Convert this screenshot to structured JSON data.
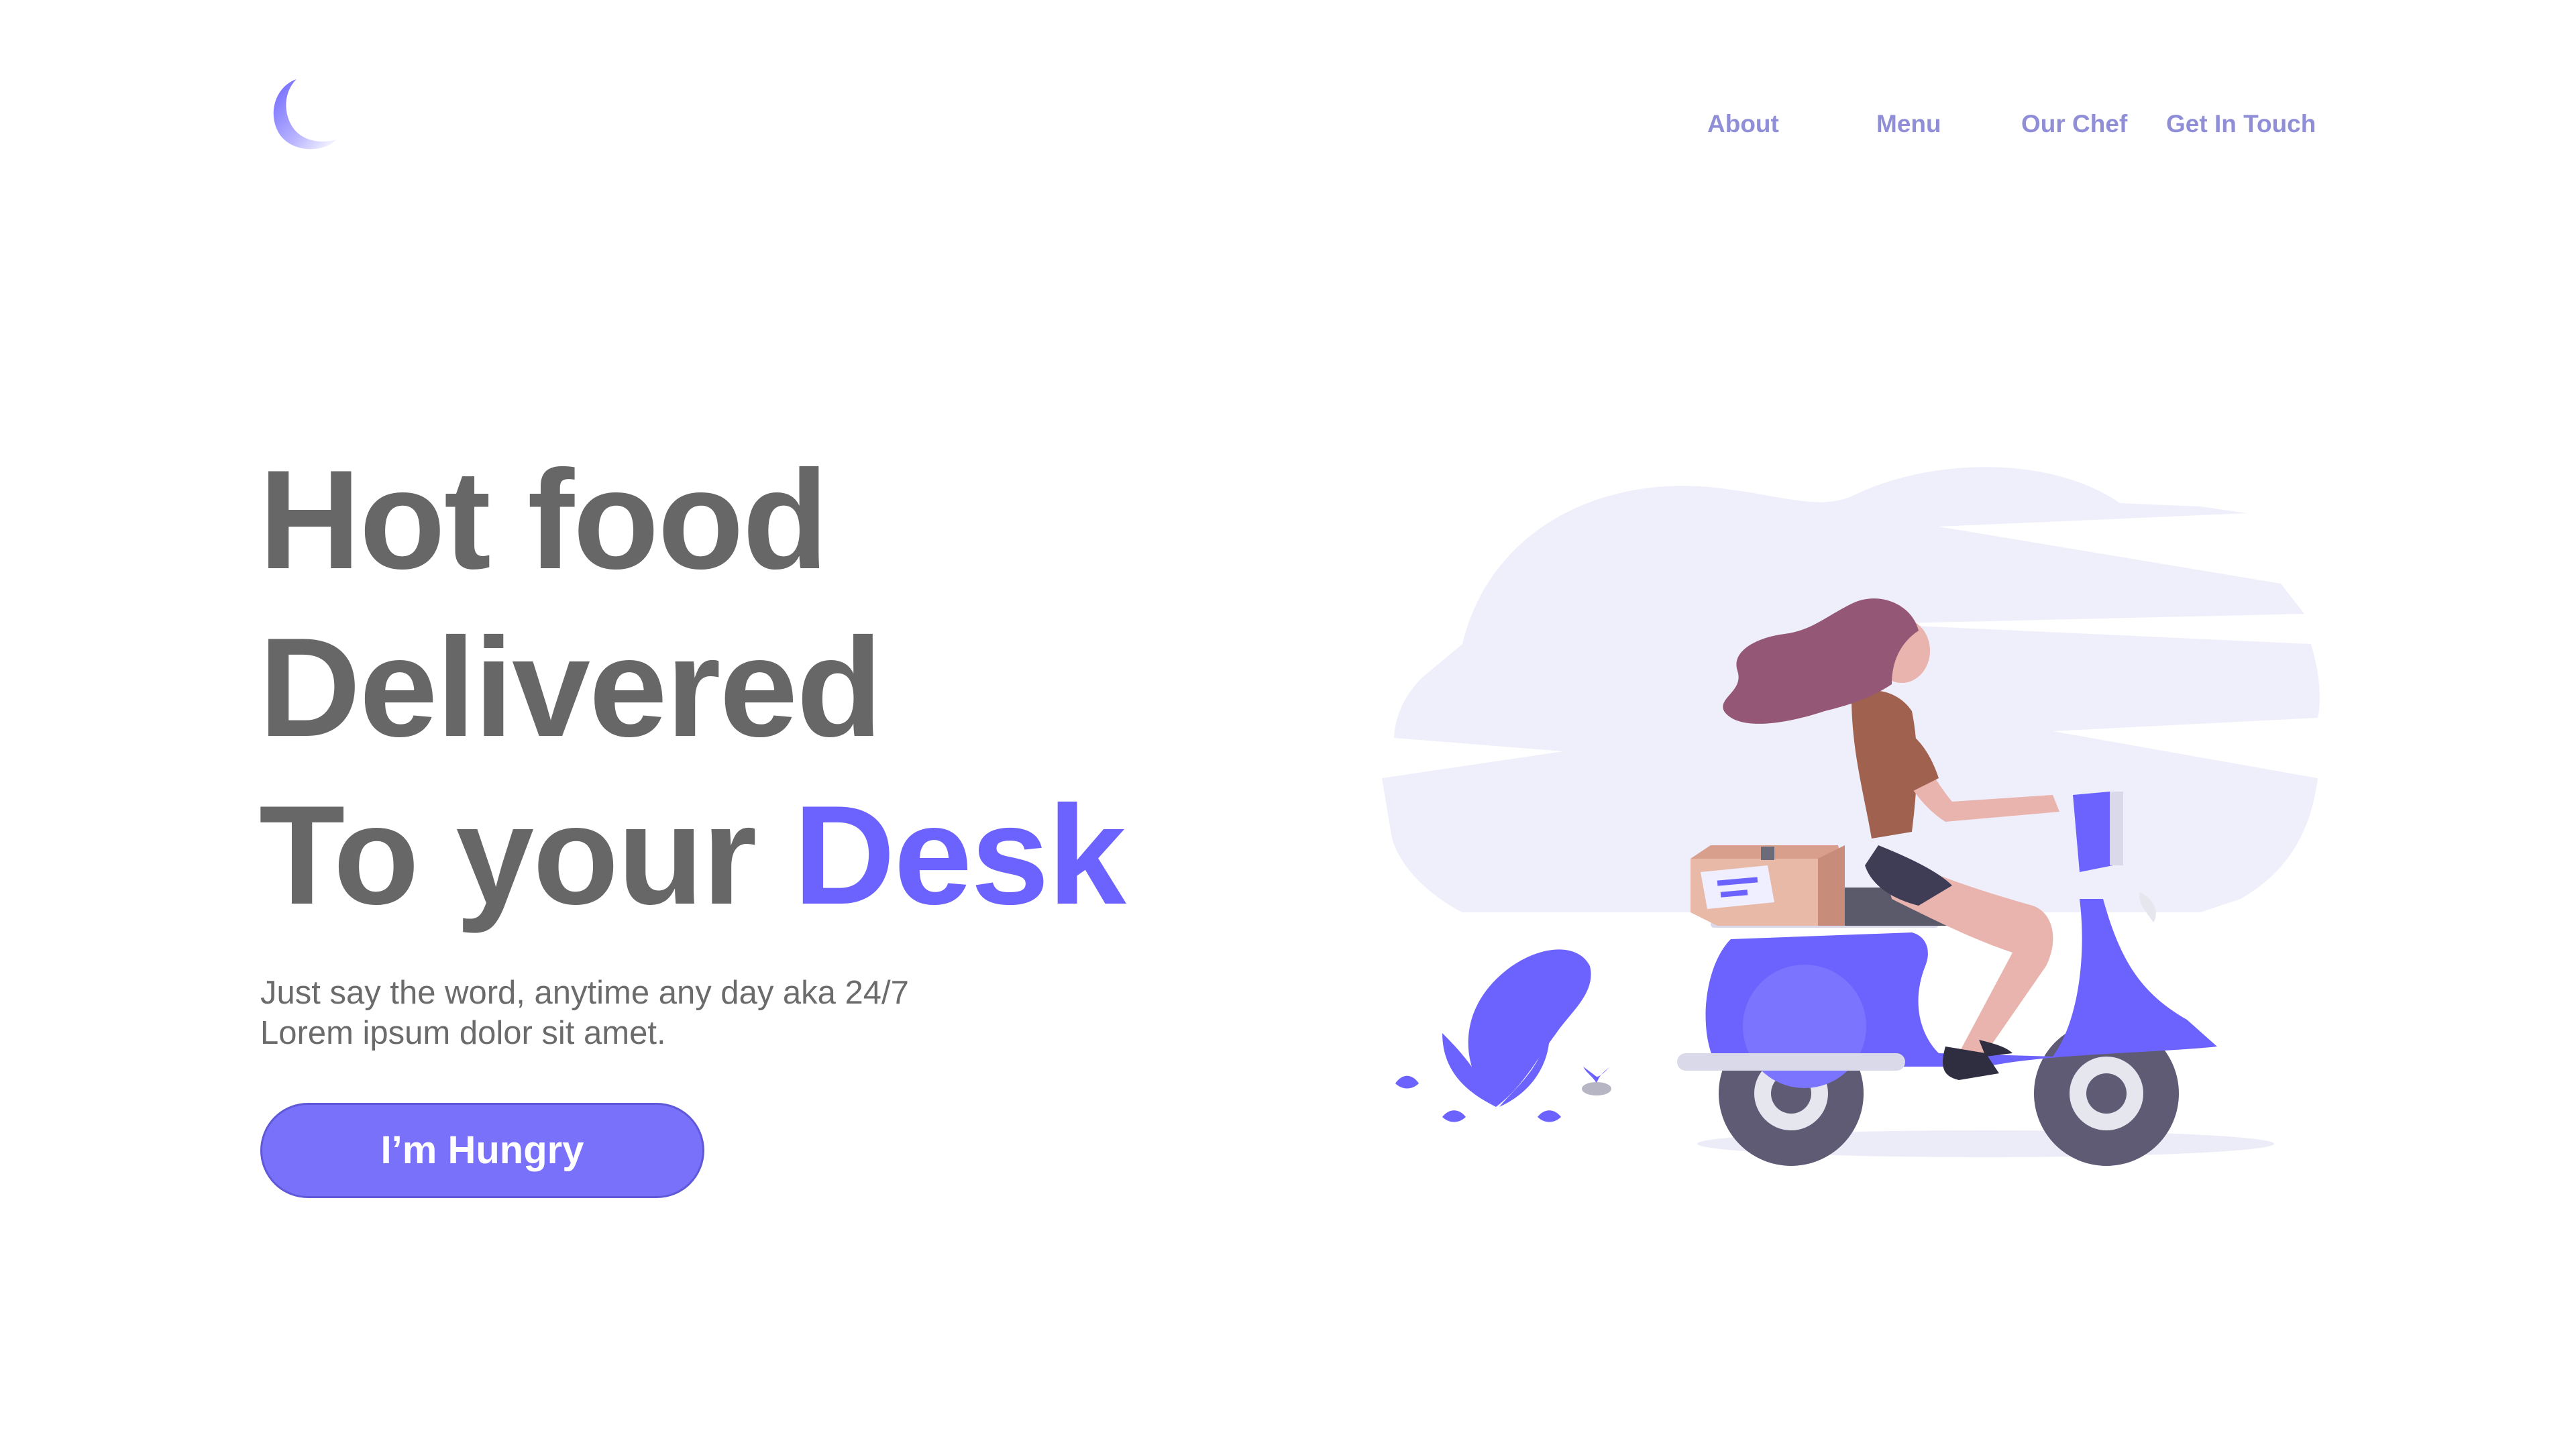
{
  "brand": {
    "logo_icon": "crescent-moon-icon",
    "accent_color": "#6c63ff"
  },
  "nav": {
    "items": [
      {
        "label": "About"
      },
      {
        "label": "Menu"
      },
      {
        "label": "Our Chef"
      },
      {
        "label": "Get In Touch"
      }
    ],
    "link_color": "#8f8ed6"
  },
  "hero": {
    "line1": "Hot food",
    "line2": "Delivered",
    "line3_prefix": "To your",
    "line3_accent": "Desk",
    "subtitle_line1": "Just say the word, anytime any day aka 24/7",
    "subtitle_line2": "Lorem ipsum dolor sit amet.",
    "cta_label": "I’m Hungry"
  },
  "illustration": {
    "subject": "delivery-scooter-illustration",
    "colors": {
      "cloud": "#efeffb",
      "scooter": "#6c63ff",
      "hair": "#955776",
      "shirt": "#a0614f",
      "skin": "#e9b3ae",
      "box": "#e8b9a6",
      "wheel": "#5f5b75"
    }
  }
}
